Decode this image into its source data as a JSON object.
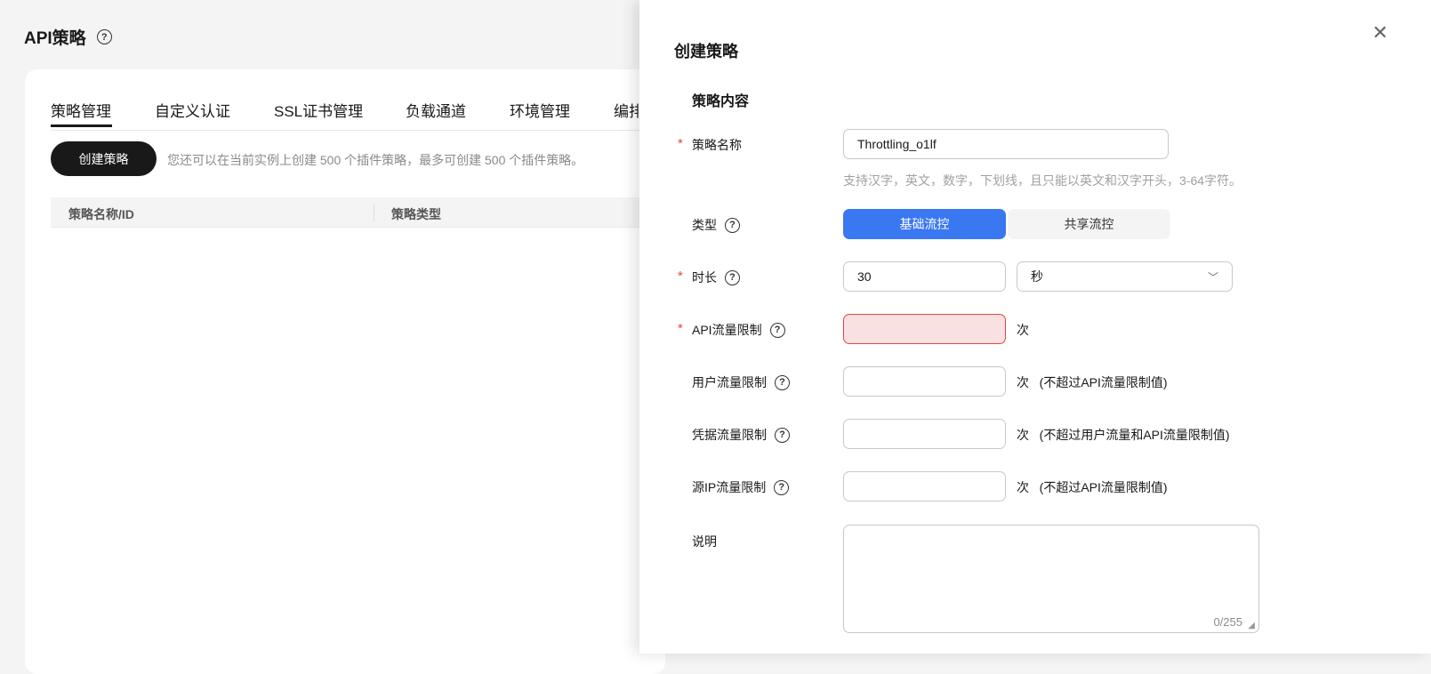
{
  "page": {
    "title": "API策略"
  },
  "tabs": [
    "策略管理",
    "自定义认证",
    "SSL证书管理",
    "负载通道",
    "环境管理",
    "编排"
  ],
  "toolbar": {
    "create_label": "创建策略",
    "hint": "您还可以在当前实例上创建 500 个插件策略，最多可创建 500 个插件策略。"
  },
  "table": {
    "columns": [
      "策略名称/ID",
      "策略类型"
    ]
  },
  "drawer": {
    "title": "创建策略",
    "section": "策略内容",
    "name": {
      "label": "策略名称",
      "value": "Throttling_o1lf",
      "hint": "支持汉字，英文，数字，下划线，且只能以英文和汉字开头，3-64字符。"
    },
    "type": {
      "label": "类型",
      "options": [
        "基础流控",
        "共享流控"
      ],
      "selected": "基础流控"
    },
    "duration": {
      "label": "时长",
      "value": "30",
      "unit": "秒"
    },
    "api_limit": {
      "label": "API流量限制",
      "value": "",
      "unit": "次"
    },
    "user_limit": {
      "label": "用户流量限制",
      "value": "",
      "unit": "次",
      "note": "(不超过API流量限制值)"
    },
    "cred_limit": {
      "label": "凭据流量限制",
      "value": "",
      "unit": "次",
      "note": "(不超过用户流量和API流量限制值)"
    },
    "ip_limit": {
      "label": "源IP流量限制",
      "value": "",
      "unit": "次",
      "note": "(不超过API流量限制值)"
    },
    "desc": {
      "label": "说明",
      "value": "",
      "counter": "0/255"
    }
  },
  "colors": {
    "primary": "#3a78f2",
    "error": "#e0483e",
    "error_bg": "#f8e1e0"
  }
}
